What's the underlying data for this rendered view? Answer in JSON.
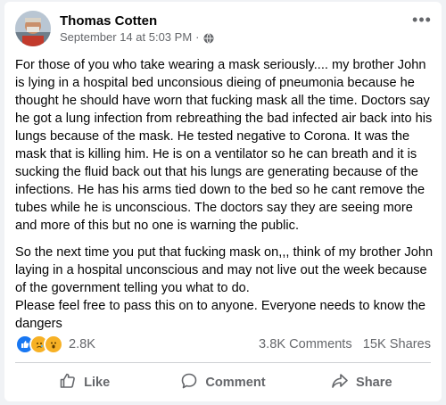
{
  "post": {
    "author": "Thomas Cotten",
    "timestamp": "September 14 at 5:03 PM",
    "separator": "·",
    "privacy_icon": "globe-icon",
    "paragraphs": [
      "For those of you who take wearing a mask seriously.... my brother John is lying in a hospital bed unconsious dieing of pneumonia because he thought he should have worn that fucking mask all the time. Doctors say he got a lung infection from rebreathing the bad infected air back into his lungs because of the mask. He tested negative to Corona. It was the mask that is killing him. He is on a ventilator so he can breath and it is sucking the fluid back out that his lungs are generating because of the infections. He has his arms tied down to the bed so he cant remove the tubes while he is unconscious. The doctors say they are seeing more and more of this but no one is warning the public.",
      "So the next time you put that fucking mask on,,, think of my brother John laying in a hospital unconscious and may not live out the week because of the government telling you what to do.\nPlease feel free to pass this on to anyone. Everyone needs to know the dangers"
    ]
  },
  "stats": {
    "reaction_icons": [
      "like-icon",
      "sad-icon",
      "wow-icon"
    ],
    "reaction_count": "2.8K",
    "comments": "3.8K Comments",
    "shares": "15K Shares"
  },
  "actions": {
    "like": "Like",
    "comment": "Comment",
    "share": "Share"
  },
  "colors": {
    "text": "#050505",
    "secondary": "#65676b",
    "like_blue": "#1877f2",
    "emoji_yellow": "#f7b125"
  }
}
